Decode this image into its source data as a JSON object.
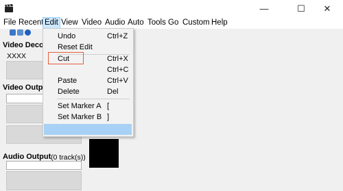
{
  "window": {
    "minimize": "—",
    "maximize": "☐",
    "close": "✕"
  },
  "menubar": {
    "items": [
      {
        "label": "File"
      },
      {
        "label": "Recent"
      },
      {
        "label": "Edit"
      },
      {
        "label": "View"
      },
      {
        "label": "Video"
      },
      {
        "label": "Audio"
      },
      {
        "label": "Auto"
      },
      {
        "label": "Tools"
      },
      {
        "label": "Go"
      },
      {
        "label": "Custom"
      },
      {
        "label": "Help"
      }
    ]
  },
  "left_panel": {
    "video_decoder_label": "Video Decoder",
    "video_decoder_value": "XXXX",
    "video_output_label": "Video Output",
    "audio_output_label": "Audio Output",
    "audio_tracks": "(0 track(s))"
  },
  "edit_menu": {
    "undo": {
      "label": "Undo",
      "shortcut": "Ctrl+Z"
    },
    "reset_edit": {
      "label": "Reset Edit"
    },
    "cut": {
      "label": "Cut",
      "shortcut": "Ctrl+X"
    },
    "copy": {
      "shortcut": "Ctrl+C"
    },
    "paste": {
      "label": "Paste",
      "shortcut": "Ctrl+V"
    },
    "delete": {
      "label": "Delete",
      "shortcut": "Del"
    },
    "marker_a": {
      "label": "Set Marker A",
      "shortcut": "["
    },
    "marker_b": {
      "label": "Set Marker B",
      "shortcut": "]"
    }
  },
  "colors": {
    "highlight": "#a9d1f5",
    "annotation": "#e85c3c"
  }
}
